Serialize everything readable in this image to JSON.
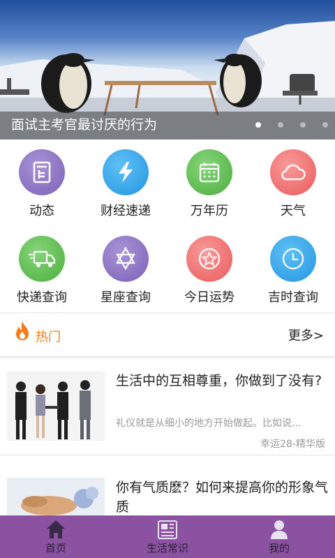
{
  "banner": {
    "title": "面试主考官最讨厌的行为",
    "slide_count": 4,
    "active_slide": 1
  },
  "grid": {
    "items": [
      {
        "label": "动态",
        "icon": "news-icon",
        "color": "#8a6fc0"
      },
      {
        "label": "财经速递",
        "icon": "lightning-icon",
        "color": "#3aa3e8"
      },
      {
        "label": "万年历",
        "icon": "calendar-icon",
        "color": "#5fbe4e"
      },
      {
        "label": "天气",
        "icon": "cloud-icon",
        "color": "#f06e6e"
      },
      {
        "label": "快递查询",
        "icon": "truck-icon",
        "color": "#5fbe4e"
      },
      {
        "label": "星座查询",
        "icon": "star-of-david-icon",
        "color": "#8a6fc0"
      },
      {
        "label": "今日运势",
        "icon": "fortune-star-icon",
        "color": "#f06e6e"
      },
      {
        "label": "吉时查询",
        "icon": "clock-icon",
        "color": "#3aa3e8"
      }
    ]
  },
  "hot": {
    "title": "热门",
    "more_label": "更多>",
    "accent_color": "#f07c1a"
  },
  "articles": [
    {
      "title": "生活中的互相尊重，你做到了没有?",
      "summary": "礼仪就是从细小的地方开始做起。比如说...",
      "source": "幸运28-精华版"
    },
    {
      "title": "你有气质麽？如何来提高你的形象气质",
      "summary": "",
      "source": ""
    }
  ],
  "bottom_nav": {
    "background": "#8a52a1",
    "items": [
      {
        "label": "首页",
        "icon": "home-icon"
      },
      {
        "label": "生活常识",
        "icon": "newspaper-icon"
      },
      {
        "label": "我的",
        "icon": "user-icon"
      }
    ]
  }
}
